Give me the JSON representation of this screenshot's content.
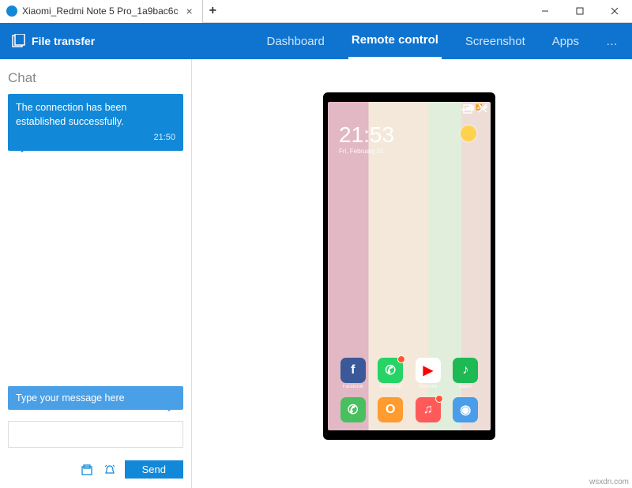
{
  "titlebar": {
    "tab_label": "Xiaomi_Redmi Note 5 Pro_1a9bac6c"
  },
  "topbar": {
    "file_transfer": "File transfer",
    "nav": {
      "dashboard": "Dashboard",
      "remote": "Remote control",
      "screenshot": "Screenshot",
      "apps": "Apps",
      "more": "…"
    }
  },
  "chat": {
    "header": "Chat",
    "message": "The connection has been established successfully.",
    "time": "21:50",
    "placeholder_bubble": "Type your message here",
    "send": "Send"
  },
  "phone": {
    "time": "21:53",
    "date": "Fri, February 01",
    "apps_row": [
      {
        "name": "Facebook",
        "color": "#3b5998",
        "glyph": "f",
        "badge": false
      },
      {
        "name": "WhatsApp",
        "color": "#25d366",
        "glyph": "✆",
        "badge": true
      },
      {
        "name": "YouTube",
        "color": "#ffffff",
        "glyph": "▶",
        "badge": false,
        "fg": "#ff0000"
      },
      {
        "name": "Saavn",
        "color": "#1db954",
        "glyph": "♪",
        "badge": false
      }
    ],
    "dock": [
      {
        "name": "Phone",
        "color": "#49c060",
        "glyph": "✆",
        "badge": false
      },
      {
        "name": "Browser",
        "color": "#ff9b2f",
        "glyph": "O",
        "badge": false
      },
      {
        "name": "Music",
        "color": "#ff5a5a",
        "glyph": "♫",
        "badge": true
      },
      {
        "name": "Camera",
        "color": "#4a9de8",
        "glyph": "◉",
        "badge": false
      }
    ]
  },
  "watermark": "wsxdn.com"
}
